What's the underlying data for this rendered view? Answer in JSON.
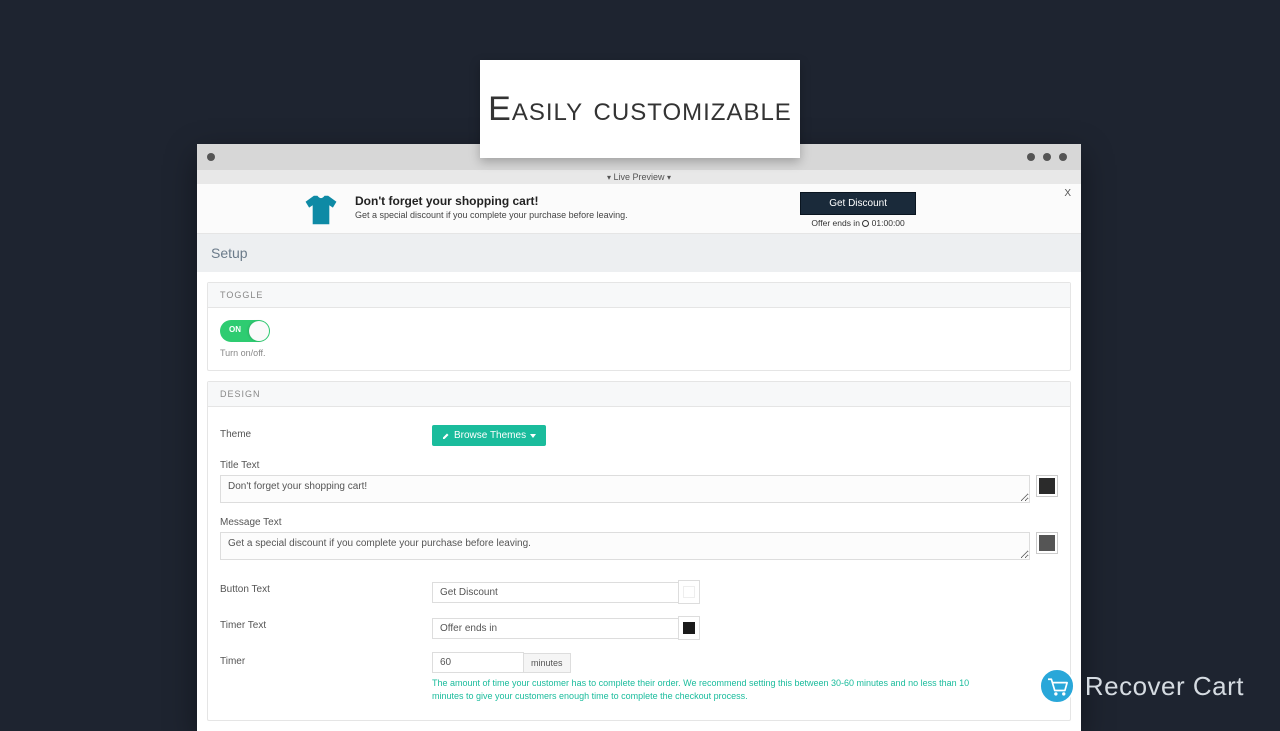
{
  "hero": {
    "title": "Easily customizable"
  },
  "livePreview": {
    "label": "Live Preview"
  },
  "preview": {
    "title": "Don't forget your shopping cart!",
    "subtitle": "Get a special discount if you complete your purchase before leaving.",
    "button": "Get Discount",
    "timerLabel": "Offer ends in",
    "timerValue": "01:00:00",
    "close": "X"
  },
  "setup": {
    "title": "Setup"
  },
  "toggleSection": {
    "header": "TOGGLE",
    "state": "ON",
    "hint": "Turn on/off."
  },
  "designSection": {
    "header": "DESIGN",
    "themeLabel": "Theme",
    "browseThemes": "Browse Themes",
    "titleTextLabel": "Title Text",
    "titleTextValue": "Don't forget your shopping cart!",
    "titleTextColor": "#2b2b2b",
    "messageTextLabel": "Message Text",
    "messageTextValue": "Get a special discount if you complete your purchase before leaving.",
    "messageTextColor": "#555555",
    "buttonTextLabel": "Button Text",
    "buttonTextValue": "Get Discount",
    "buttonTextColor": "#ffffff",
    "timerTextLabel": "Timer Text",
    "timerTextValue": "Offer ends in",
    "timerTextColor": "#1a1a1a",
    "timerLabel": "Timer",
    "timerValue": "60",
    "timerUnit": "minutes",
    "timerHelper": "The amount of time your customer has to complete their order. We recommend setting this between 30-60 minutes and no less than 10 minutes to give your customers enough time to complete the checkout process."
  },
  "brand": {
    "name": "Recover Cart"
  }
}
